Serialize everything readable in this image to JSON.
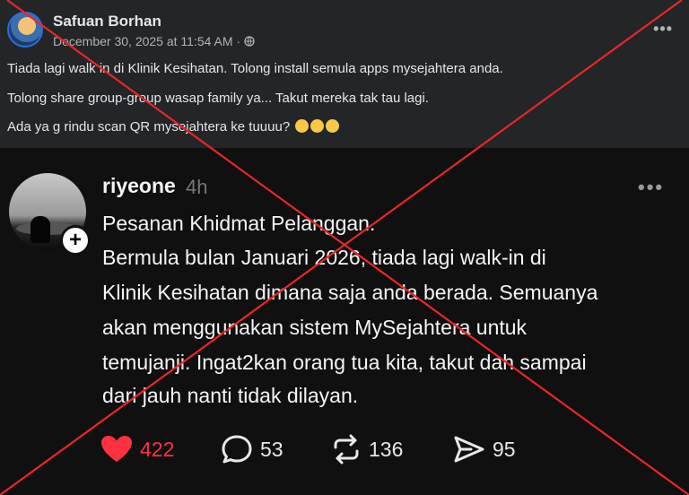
{
  "facebook_post": {
    "author": "Safuan Borhan",
    "timestamp": "December 30, 2025 at 11:54 AM",
    "separator": "·",
    "lines": [
      "Tiada lagi walk in di Klinik Kesihatan. Tolong install semula apps mysejahtera anda.",
      "Tolong share group-group wasap family ya... Takut mereka tak tau lagi.",
      "Ada ya g rindu scan QR mysejahtera ke tuuuu?"
    ],
    "more_icon": "more-dots-icon"
  },
  "threads_post": {
    "username": "riyeone",
    "time_ago": "4h",
    "follow_icon": "+",
    "lines": [
      "Pesanan Khidmat Pelanggan.",
      "Bermula bulan Januari 2026, tiada lagi walk-in di",
      "Klinik Kesihatan dimana saja anda berada. Semuanya",
      "akan menggunakan sistem MySejahtera untuk",
      "temujanji. Ingat2kan orang tua kita, takut dah sampai",
      "dari jauh nanti tidak dilayan."
    ],
    "actions": {
      "likes": "422",
      "comments": "53",
      "reposts": "136",
      "shares": "95"
    }
  },
  "overlay": {
    "color": "#e8262b",
    "meaning": "false-claim-cross"
  }
}
